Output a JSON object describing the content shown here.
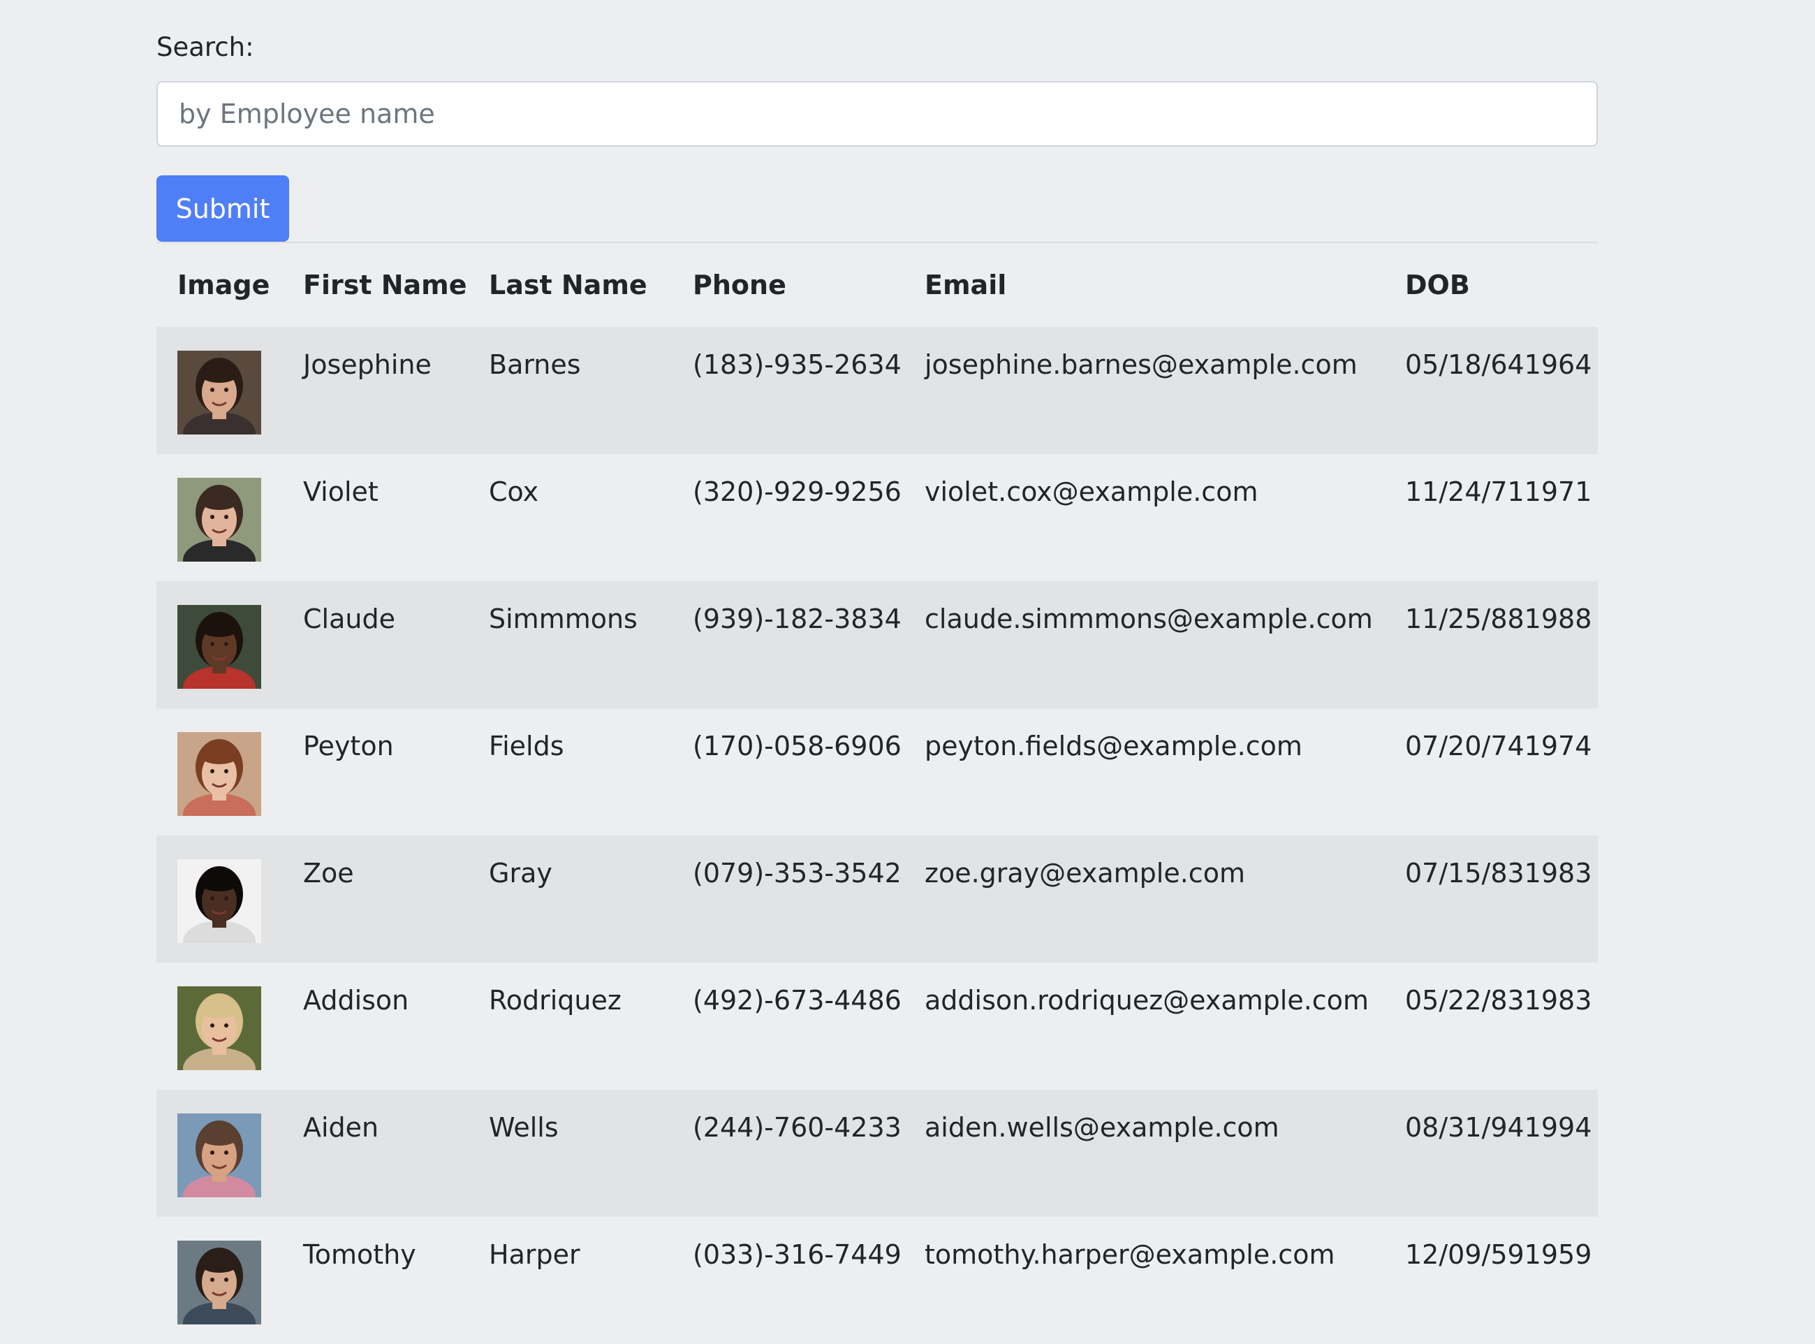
{
  "search": {
    "label": "Search:",
    "placeholder": "by Employee name",
    "value": ""
  },
  "submit_label": "Submit",
  "table": {
    "headers": [
      "Image",
      "First Name",
      "Last Name",
      "Phone",
      "Email",
      "DOB"
    ],
    "rows": [
      {
        "first": "Josephine",
        "last": "Barnes",
        "phone": "(183)-935-2634",
        "email": "josephine.barnes@example.com",
        "dob": "05/18/641964",
        "avatar": {
          "bg": "#5a4a3e",
          "skin": "#d9a98e",
          "hair": "#2b1d16",
          "shirt": "#3a3030"
        }
      },
      {
        "first": "Violet",
        "last": "Cox",
        "phone": "(320)-929-9256",
        "email": "violet.cox@example.com",
        "dob": "11/24/711971",
        "avatar": {
          "bg": "#8f9a7c",
          "skin": "#e2b49c",
          "hair": "#3a2a22",
          "shirt": "#2a2a2a"
        }
      },
      {
        "first": "Claude",
        "last": "Simmmons",
        "phone": "(939)-182-3834",
        "email": "claude.simmmons@example.com",
        "dob": "11/25/881988",
        "avatar": {
          "bg": "#3e4b3a",
          "skin": "#5e3a26",
          "hair": "#1c120d",
          "shirt": "#b8332c"
        }
      },
      {
        "first": "Peyton",
        "last": "Fields",
        "phone": "(170)-058-6906",
        "email": "peyton.fields@example.com",
        "dob": "07/20/741974",
        "avatar": {
          "bg": "#c8a488",
          "skin": "#eac0a4",
          "hair": "#7a3f22",
          "shirt": "#c96e5a"
        }
      },
      {
        "first": "Zoe",
        "last": "Gray",
        "phone": "(079)-353-3542",
        "email": "zoe.gray@example.com",
        "dob": "07/15/831983",
        "avatar": {
          "bg": "#f2f2f2",
          "skin": "#4a2e22",
          "hair": "#0e0a08",
          "shirt": "#dcdcdc"
        }
      },
      {
        "first": "Addison",
        "last": "Rodriquez",
        "phone": "(492)-673-4486",
        "email": "addison.rodriquez@example.com",
        "dob": "05/22/831983",
        "avatar": {
          "bg": "#5c6a3a",
          "skin": "#e8c09e",
          "hair": "#d8c08a",
          "shirt": "#c9b08c"
        }
      },
      {
        "first": "Aiden",
        "last": "Wells",
        "phone": "(244)-760-4233",
        "email": "aiden.wells@example.com",
        "dob": "08/31/941994",
        "avatar": {
          "bg": "#7a9ab8",
          "skin": "#d6a282",
          "hair": "#5a4030",
          "shirt": "#d28aa0"
        }
      },
      {
        "first": "Tomothy",
        "last": "Harper",
        "phone": "(033)-316-7449",
        "email": "tomothy.harper@example.com",
        "dob": "12/09/591959",
        "avatar": {
          "bg": "#6c7a84",
          "skin": "#d6aa8c",
          "hair": "#2a1e18",
          "shirt": "#3c4a5a"
        }
      }
    ]
  }
}
